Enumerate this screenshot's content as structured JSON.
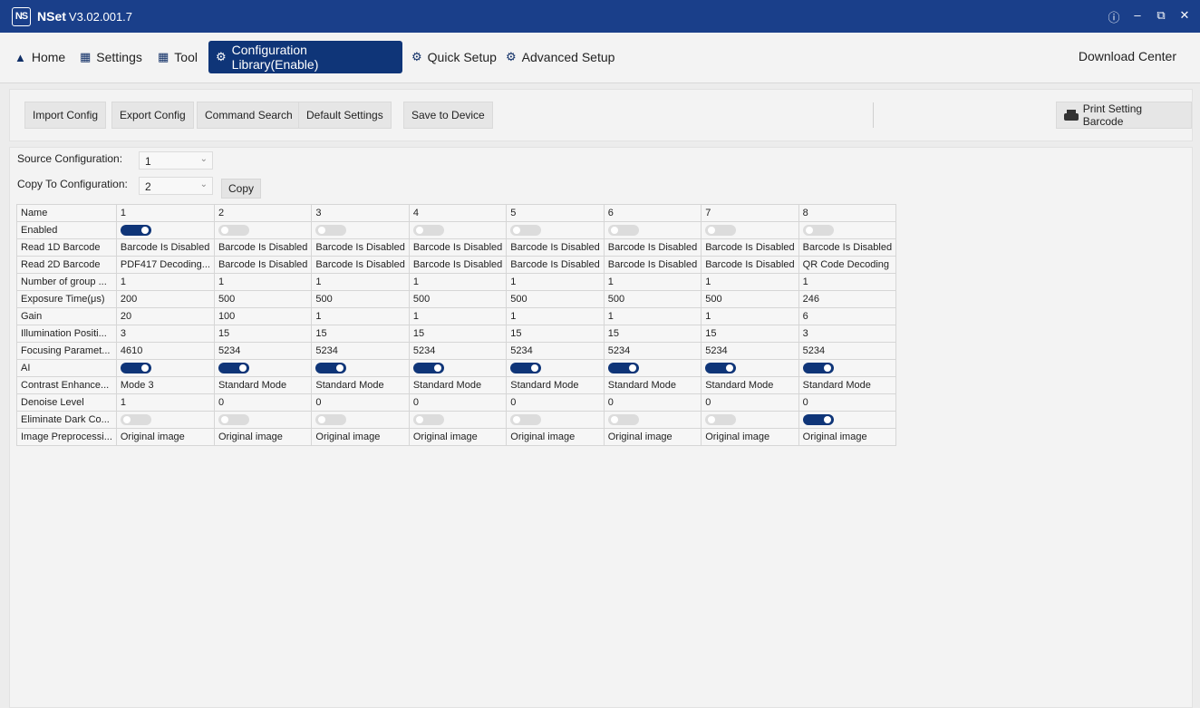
{
  "app": {
    "logo": "NS",
    "name": "NSet",
    "version": "V3.02.001.7"
  },
  "window_controls": [
    "info-icon",
    "minimize-icon",
    "restore-icon",
    "close-icon"
  ],
  "nav": {
    "home": "Home",
    "settings": "Settings",
    "tool": "Tool",
    "config_library": "Configuration Library(Enable)",
    "quick_setup": "Quick Setup",
    "advanced_setup": "Advanced Setup",
    "download_center": "Download Center"
  },
  "toolbar": {
    "import": "Import Config",
    "export": "Export Config",
    "command_search": "Command Search",
    "default_settings": "Default Settings",
    "save_to_device": "Save to Device",
    "print_barcode": "Print Setting Barcode"
  },
  "source_config": {
    "label": "Source Configuration:",
    "value": "1"
  },
  "copy_to_config": {
    "label": "Copy To Configuration:",
    "value": "2",
    "button": "Copy"
  },
  "table": {
    "header_label": "Name",
    "columns": [
      "1",
      "2",
      "3",
      "4",
      "5",
      "6",
      "7",
      "8"
    ],
    "rows": [
      {
        "label": "Enabled",
        "type": "toggle",
        "values": [
          true,
          false,
          false,
          false,
          false,
          false,
          false,
          false
        ]
      },
      {
        "label": "Read 1D Barcode",
        "type": "text",
        "values": [
          "Barcode Is Disabled",
          "Barcode Is Disabled",
          "Barcode Is Disabled",
          "Barcode Is Disabled",
          "Barcode Is Disabled",
          "Barcode Is Disabled",
          "Barcode Is Disabled",
          "Barcode Is Disabled"
        ]
      },
      {
        "label": "Read 2D Barcode",
        "type": "text",
        "values": [
          "PDF417 Decoding...",
          "Barcode Is Disabled",
          "Barcode Is Disabled",
          "Barcode Is Disabled",
          "Barcode Is Disabled",
          "Barcode Is Disabled",
          "Barcode Is Disabled",
          "QR Code Decoding"
        ]
      },
      {
        "label": "Number of group ...",
        "type": "text",
        "values": [
          "1",
          "1",
          "1",
          "1",
          "1",
          "1",
          "1",
          "1"
        ]
      },
      {
        "label": "Exposure Time(μs)",
        "type": "text",
        "values": [
          "200",
          "500",
          "500",
          "500",
          "500",
          "500",
          "500",
          "246"
        ]
      },
      {
        "label": "Gain",
        "type": "text",
        "values": [
          "20",
          "100",
          "1",
          "1",
          "1",
          "1",
          "1",
          "6"
        ]
      },
      {
        "label": "Illumination Positi...",
        "type": "text",
        "values": [
          "3",
          "15",
          "15",
          "15",
          "15",
          "15",
          "15",
          "3"
        ]
      },
      {
        "label": "Focusing Paramet...",
        "type": "text",
        "values": [
          "4610",
          "5234",
          "5234",
          "5234",
          "5234",
          "5234",
          "5234",
          "5234"
        ]
      },
      {
        "label": "AI",
        "type": "toggle",
        "values": [
          true,
          true,
          true,
          true,
          true,
          true,
          true,
          true
        ]
      },
      {
        "label": "Contrast Enhance...",
        "type": "text",
        "values": [
          "Mode 3",
          "Standard Mode",
          "Standard Mode",
          "Standard Mode",
          "Standard Mode",
          "Standard Mode",
          "Standard Mode",
          "Standard Mode"
        ]
      },
      {
        "label": "Denoise  Level",
        "type": "text",
        "values": [
          "1",
          "0",
          "0",
          "0",
          "0",
          "0",
          "0",
          "0"
        ]
      },
      {
        "label": "Eliminate Dark Co...",
        "type": "toggle",
        "values": [
          false,
          false,
          false,
          false,
          false,
          false,
          false,
          true
        ]
      },
      {
        "label": "Image Preprocessi...",
        "type": "text",
        "values": [
          "Original image",
          "Original image",
          "Original image",
          "Original image",
          "Original image",
          "Original image",
          "Original image",
          "Original image"
        ]
      }
    ]
  },
  "colors": {
    "titlebar": "#1a3f8a",
    "accent": "#0f3578",
    "toggle_off": "#dcdcdc"
  }
}
